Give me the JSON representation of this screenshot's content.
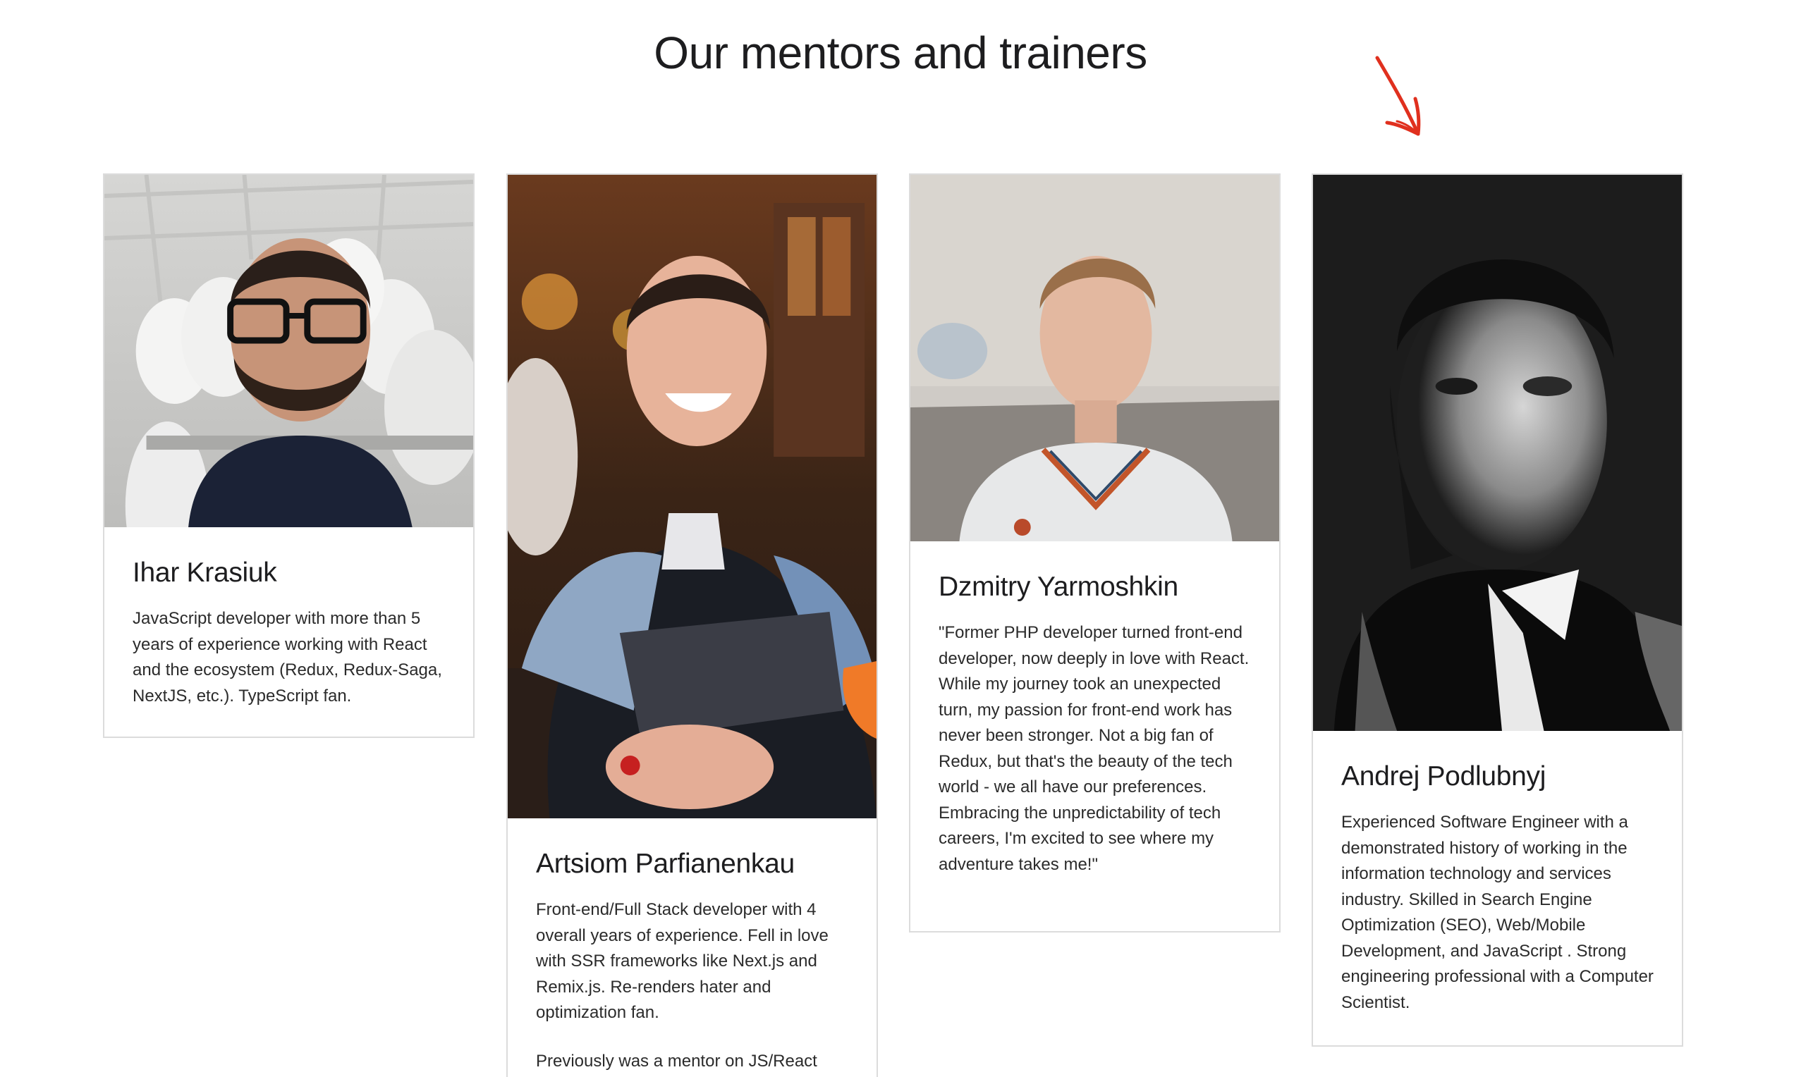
{
  "section": {
    "title": "Our mentors and trainers"
  },
  "colors": {
    "accent_arrow": "#e0301e",
    "card_border": "#dcdcdc",
    "text": "#1d1d1f"
  },
  "mentors": [
    {
      "name": "Ihar Krasiuk",
      "description": "JavaScript developer with more than 5 years of experience working with React and the ecosystem (Redux, Redux-Saga, NextJS, etc.). TypeScript fan.",
      "photo_alt": "Portrait of Ihar Krasiuk wearing glasses next to white busts"
    },
    {
      "name": "Artsiom Parfianenkau",
      "description": "Front-end/Full Stack developer with 4 overall years of experience. Fell in love with SSR frameworks like Next.js and Remix.js. Re-renders hater and optimization fan.",
      "description_2": "Previously was a mentor on JS/React courses. Currently focused on RSS",
      "photo_alt": "Portrait of Artsiom Parfianenkau smiling at a table"
    },
    {
      "name": "Dzmitry Yarmoshkin",
      "description": "\"Former PHP developer turned front-end developer, now deeply in love with React. While my journey took an unexpected turn, my passion for front-end work has never been stronger. Not a big fan of Redux, but that's the beauty of the tech world - we all have our preferences. Embracing the unpredictability of tech careers, I'm excited to see where my adventure takes me!\"",
      "photo_alt": "Portrait of Dzmitry Yarmoshkin in a white polo shirt"
    },
    {
      "name": "Andrej Podlubnyj",
      "description": "Experienced Software Engineer with a demonstrated history of working in the information technology and services industry. Skilled in Search Engine Optimization (SEO), Web/Mobile Development, and JavaScript . Strong engineering professional with a Computer Scientist.",
      "photo_alt": "Black and white portrait of Andrej Podlubnyj"
    }
  ]
}
